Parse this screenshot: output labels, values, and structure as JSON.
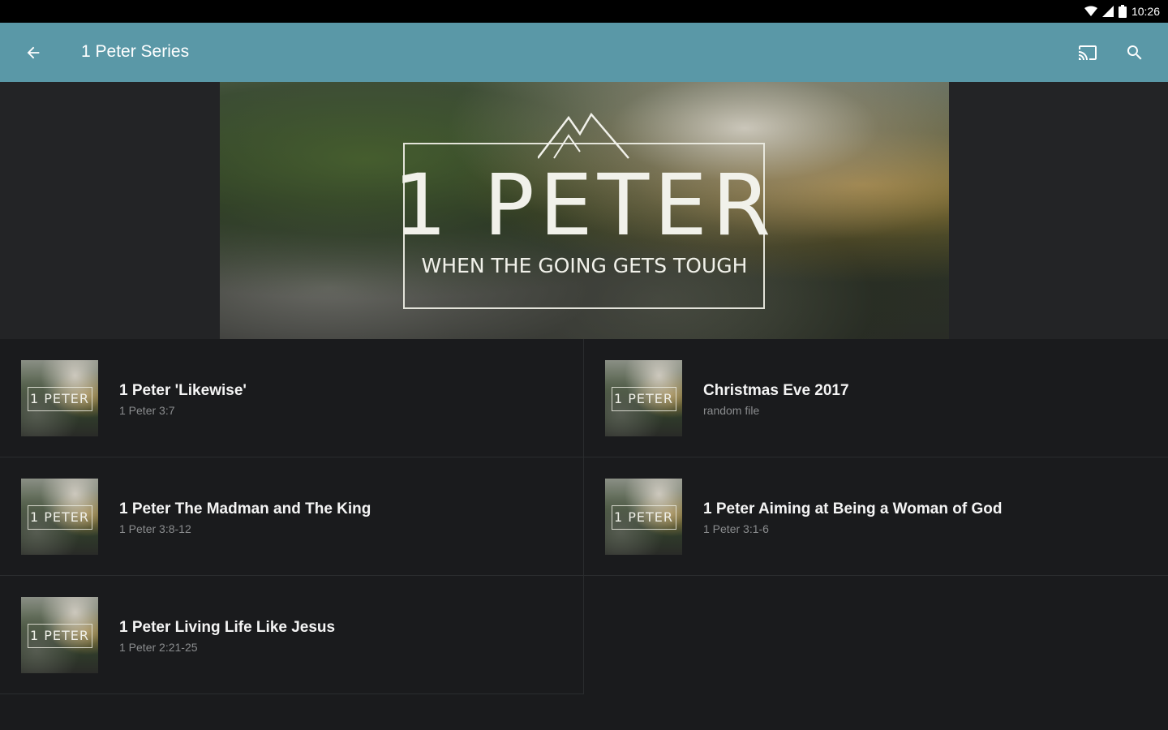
{
  "status_bar": {
    "time": "10:26"
  },
  "app_bar": {
    "title": "1 Peter Series",
    "back_icon": "arrow-back-icon",
    "cast_icon": "cast-icon",
    "search_icon": "search-icon",
    "color": "#5a98a7"
  },
  "banner": {
    "title": "1 PETER",
    "subtitle": "WHEN THE GOING GETS TOUGH"
  },
  "thumbnail_text": "1 PETER",
  "items": [
    {
      "title": "1 Peter 'Likewise'",
      "subtitle": "1 Peter 3:7"
    },
    {
      "title": "Christmas Eve 2017",
      "subtitle": "random file"
    },
    {
      "title": "1 Peter The Madman and The King",
      "subtitle": "1 Peter 3:8-12"
    },
    {
      "title": "1 Peter Aiming at Being a Woman of God",
      "subtitle": "1 Peter 3:1-6"
    },
    {
      "title": "1 Peter Living Life Like Jesus",
      "subtitle": "1 Peter 2:21-25"
    }
  ]
}
